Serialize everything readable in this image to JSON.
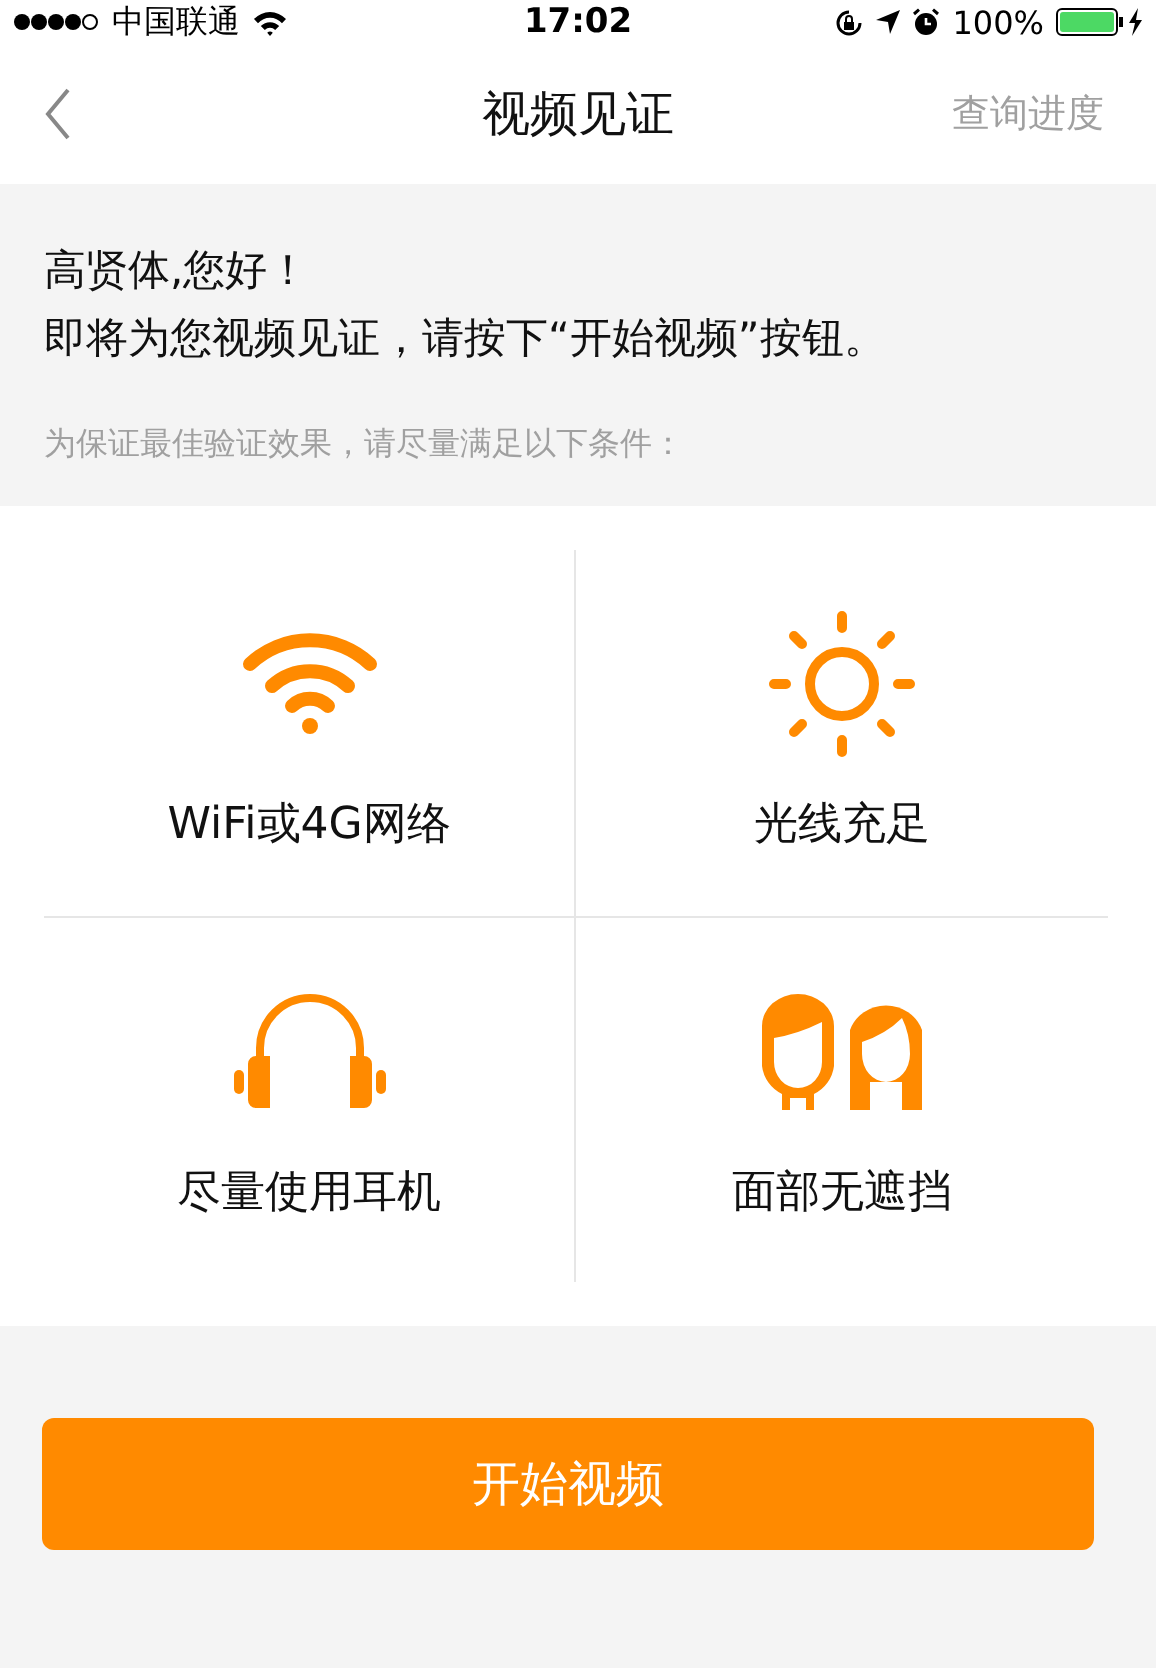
{
  "status_bar": {
    "carrier": "中国联通",
    "time": "17:02",
    "battery": "100%"
  },
  "nav": {
    "title": "视频见证",
    "action": "查询进度"
  },
  "intro": {
    "greeting": "高贤体,您好！",
    "message": "即将为您视频见证，请按下“开始视频”按钮。",
    "hint": "为保证最佳验证效果，请尽量满足以下条件："
  },
  "conditions": [
    {
      "kind": "wifi",
      "label": "WiFi或4G网络"
    },
    {
      "kind": "sun",
      "label": "光线充足"
    },
    {
      "kind": "headphones",
      "label": "尽量使用耳机"
    },
    {
      "kind": "faces",
      "label": "面部无遮挡"
    }
  ],
  "start_button": "开始视频"
}
